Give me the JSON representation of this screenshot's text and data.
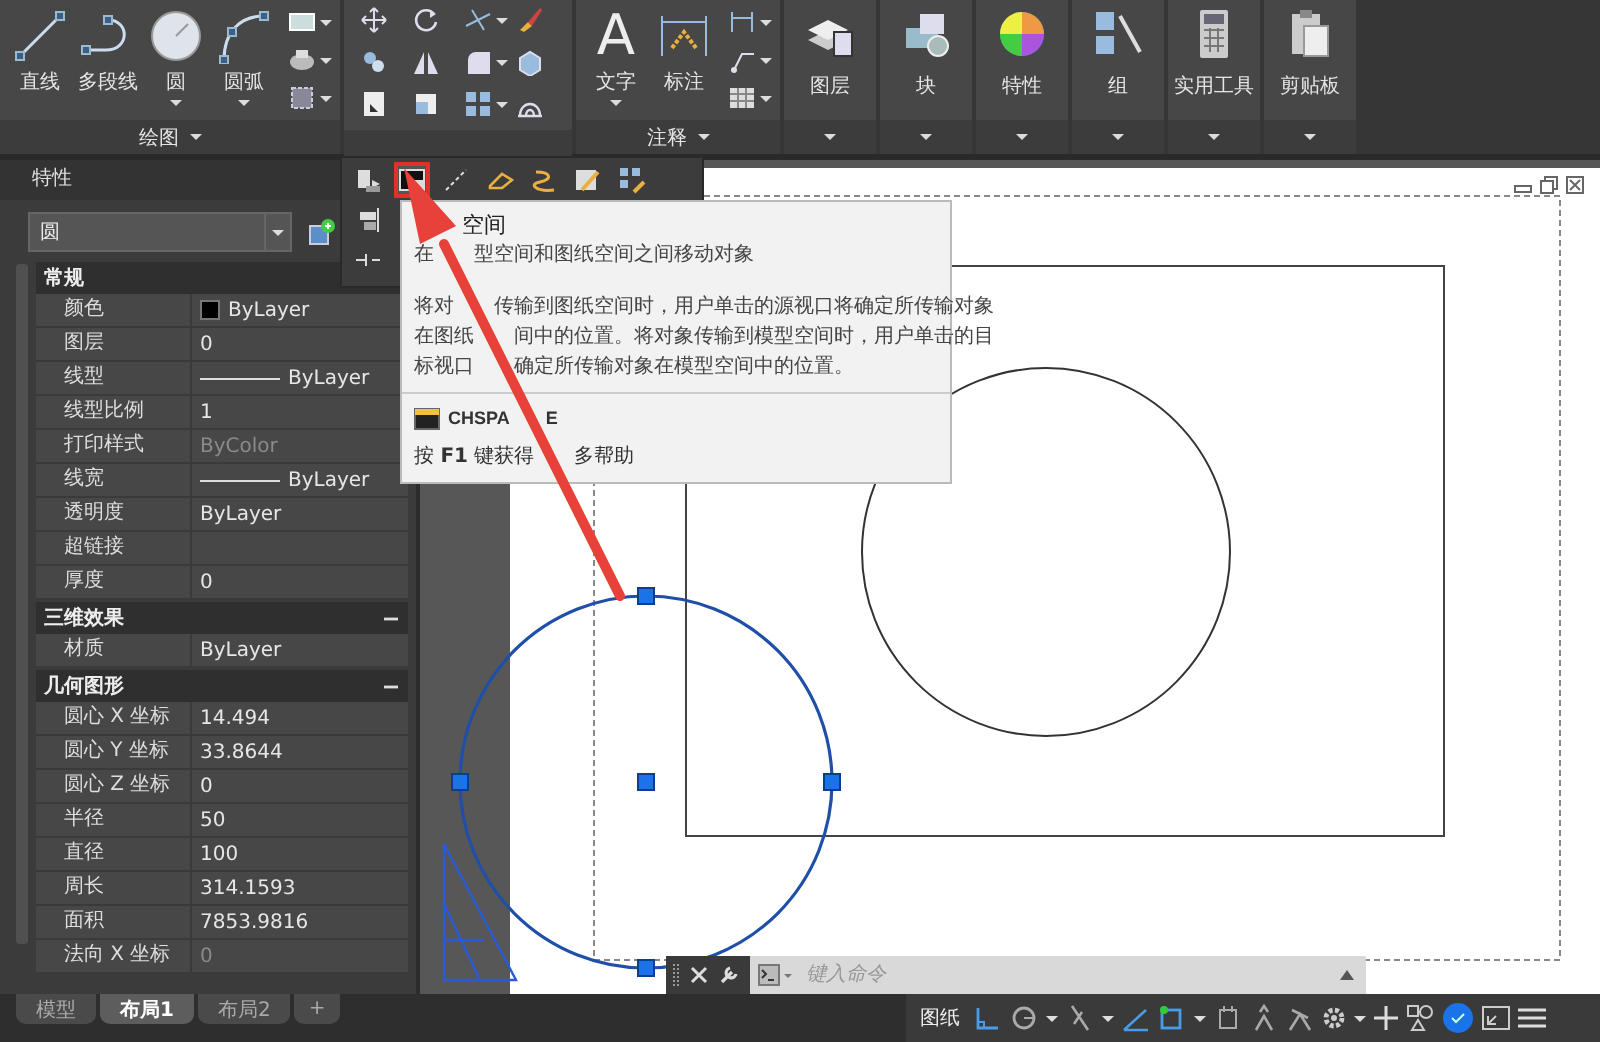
{
  "ribbon": {
    "draw_panel": {
      "title": "绘图",
      "tools": [
        {
          "label": "直线",
          "dropdown": false
        },
        {
          "label": "多段线",
          "dropdown": false
        },
        {
          "label": "圆",
          "dropdown": true
        },
        {
          "label": "圆弧",
          "dropdown": true
        }
      ]
    },
    "annotation_panel": {
      "title": "注释",
      "tools": [
        {
          "label": "文字",
          "glyph": "A",
          "dropdown": true
        },
        {
          "label": "标注",
          "dropdown": false
        }
      ]
    },
    "panels": [
      {
        "label": "图层"
      },
      {
        "label": "块"
      },
      {
        "label": "特性"
      },
      {
        "label": "组"
      },
      {
        "label": "实用工具"
      },
      {
        "label": "剪贴板"
      }
    ]
  },
  "flyout": {
    "tools": [
      {
        "selected": false
      },
      {
        "selected": true
      },
      {
        "selected": false
      },
      {
        "selected": false
      },
      {
        "selected": false
      },
      {
        "selected": false
      },
      {
        "selected": false
      }
    ]
  },
  "tooltip": {
    "title": [
      "空间"
    ],
    "lines": [
      [
        "在",
        "型空间和图纸空间之间移动对象"
      ],
      [
        "将对",
        "传输到图纸空间时，用户单击的源视口将确定所传输对象"
      ],
      [
        "在图纸",
        "间中的位置。将对象传输到模型空间时，用户单击的目"
      ],
      [
        "标视口",
        "确定所传输对象在模型空间中的位置。"
      ]
    ],
    "command": [
      "CHSPA",
      "E"
    ],
    "help": [
      "按 **F1** 键获得",
      "多帮助"
    ]
  },
  "properties_palette": {
    "title": "特性",
    "object_type": "圆",
    "sections": [
      {
        "title": "常规",
        "expanded": true,
        "rows": [
          {
            "label": "颜色",
            "value": "ByLayer",
            "kind": "color",
            "disabled": false
          },
          {
            "label": "图层",
            "value": "0",
            "kind": "text",
            "disabled": false
          },
          {
            "label": "线型",
            "value": "ByLayer",
            "kind": "line",
            "disabled": false
          },
          {
            "label": "线型比例",
            "value": "1",
            "kind": "text",
            "disabled": false
          },
          {
            "label": "打印样式",
            "value": "ByColor",
            "kind": "text",
            "disabled": true
          },
          {
            "label": "线宽",
            "value": "ByLayer",
            "kind": "line",
            "disabled": false
          },
          {
            "label": "透明度",
            "value": "ByLayer",
            "kind": "text",
            "disabled": false
          },
          {
            "label": "超链接",
            "kind": "text",
            "disabled": false
          },
          {
            "label": "厚度",
            "value": "0",
            "kind": "text",
            "disabled": false
          }
        ]
      },
      {
        "title": "三维效果",
        "expanded": true,
        "rows": [
          {
            "label": "材质",
            "value": "ByLayer",
            "kind": "text",
            "disabled": false
          }
        ]
      },
      {
        "title": "几何图形",
        "expanded": true,
        "rows": [
          {
            "label": "圆心 X 坐标",
            "value": "14.494",
            "kind": "text",
            "disabled": false
          },
          {
            "label": "圆心 Y 坐标",
            "value": "33.8644",
            "kind": "text",
            "disabled": false
          },
          {
            "label": "圆心 Z 坐标",
            "value": "0",
            "kind": "text",
            "disabled": false
          },
          {
            "label": "半径",
            "value": "50",
            "kind": "text",
            "disabled": false
          },
          {
            "label": "直径",
            "value": "100",
            "kind": "text",
            "disabled": false
          },
          {
            "label": "周长",
            "value": "314.1593",
            "kind": "text",
            "disabled": false
          },
          {
            "label": "面积",
            "value": "7853.9816",
            "kind": "text",
            "disabled": false
          },
          {
            "label": "法向 X 坐标",
            "value": "0",
            "kind": "text",
            "disabled": true
          }
        ]
      }
    ]
  },
  "command_line": {
    "placeholder": "键入命令"
  },
  "layout_tabs": [
    {
      "label": "模型",
      "selected": false
    },
    {
      "label": "布局1",
      "selected": true
    },
    {
      "label": "布局2",
      "selected": false
    }
  ],
  "new_tab": "+",
  "status_bar": {
    "space": "图纸",
    "toggles": [
      {
        "on": true
      },
      {
        "on": false
      },
      {
        "on": false
      },
      {
        "on": true
      },
      {
        "on": true
      },
      {
        "on": false
      },
      {
        "on": false
      },
      {
        "on": false
      }
    ]
  }
}
